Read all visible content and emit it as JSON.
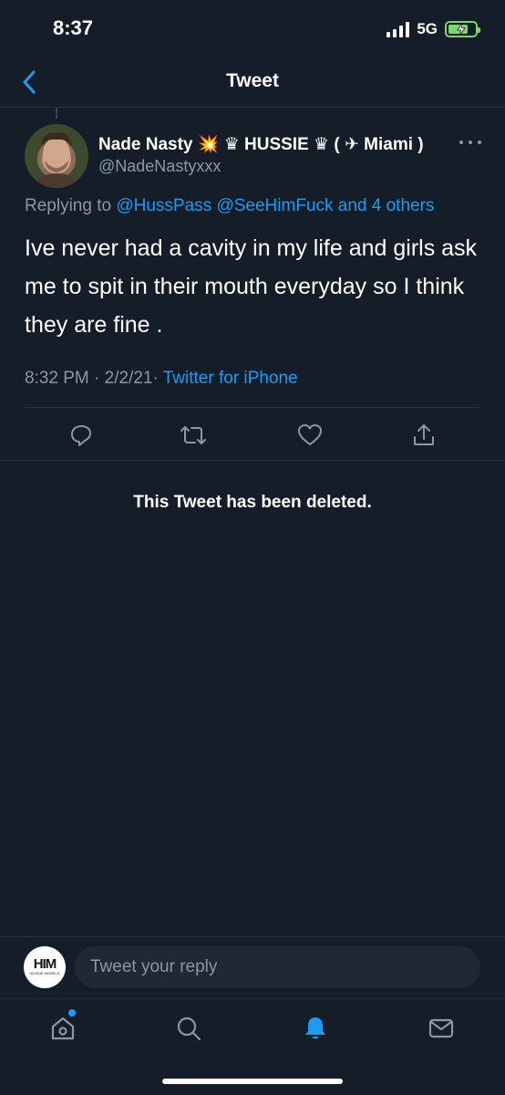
{
  "status_bar": {
    "time": "8:37",
    "network": "5G",
    "battery_level": 0.7,
    "battery_charging": true
  },
  "nav": {
    "title": "Tweet"
  },
  "tweet": {
    "author_name": "Nade Nasty 💥 ♛ HUSSIE ♛ ( ✈ Miami )",
    "author_handle": "@NadeNastyxxx",
    "replying_prefix": "Replying to",
    "replying_user1": "@HussPass",
    "replying_user2": "@SeeHimFuck",
    "replying_others": "and 4 others",
    "text": "Ive never had a cavity in my life and girls ask me to spit in their mouth everyday so I think they are fine .",
    "time": "8:32 PM",
    "separator": "·",
    "date": "2/2/21",
    "source": "Twitter for iPhone"
  },
  "deleted_notice": "This Tweet has been deleted.",
  "reply": {
    "placeholder": "Tweet your reply",
    "avatar_logo": "HIM",
    "avatar_logo_sub": "HUSSIE MODELS"
  },
  "icons": {
    "back": "chevron-left-icon",
    "more": "more-horizontal-icon",
    "reply": "reply-icon",
    "retweet": "retweet-icon",
    "like": "heart-icon",
    "share": "share-icon",
    "home": "home-icon",
    "search": "search-icon",
    "notifications": "bell-icon",
    "messages": "mail-icon"
  },
  "colors": {
    "background": "#151d28",
    "accent": "#1d9bf0",
    "secondary_text": "#8899a6",
    "battery": "#7fd46a"
  }
}
